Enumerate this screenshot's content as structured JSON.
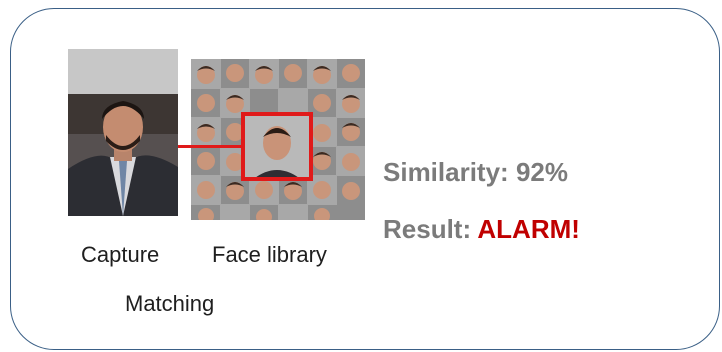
{
  "photos": {
    "capture_alt": "Capture",
    "library_alt": "Face library"
  },
  "labels": {
    "capture": "Capture",
    "face_library": "Face library",
    "matching": "Matching"
  },
  "result_panel": {
    "similarity_label": "Similarity:",
    "similarity_value": "92%",
    "result_label": "Result:",
    "result_value": "ALARM!"
  },
  "colors": {
    "frame_border": "#3a5f86",
    "match_highlight": "#e01a1a",
    "stat_text": "#7b7b7b",
    "alarm_text": "#c00000"
  }
}
